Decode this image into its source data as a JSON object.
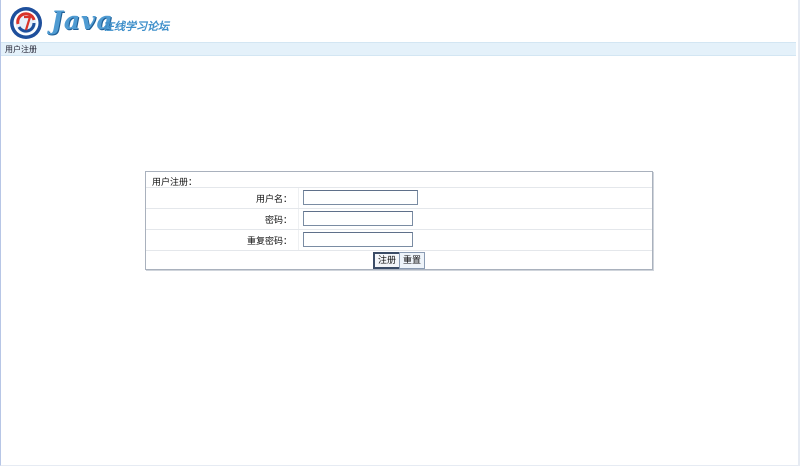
{
  "header": {
    "brand_main": "Java",
    "brand_sub": "在线学习论坛",
    "logo_icon": "forum-logo-icon"
  },
  "breadcrumb": {
    "current": "用户注册"
  },
  "form": {
    "title": "用户注册：",
    "fields": [
      {
        "label": "用户名：",
        "value": "",
        "type": "text"
      },
      {
        "label": "密码：",
        "value": "",
        "type": "password"
      },
      {
        "label": "重复密码：",
        "value": "",
        "type": "password"
      }
    ],
    "submit_label": "注册",
    "reset_label": "重置"
  },
  "colors": {
    "accent": "#4f9bd2",
    "breadcrumb_bg": "#e4f1fa",
    "panel_border": "#a9b1bd"
  }
}
